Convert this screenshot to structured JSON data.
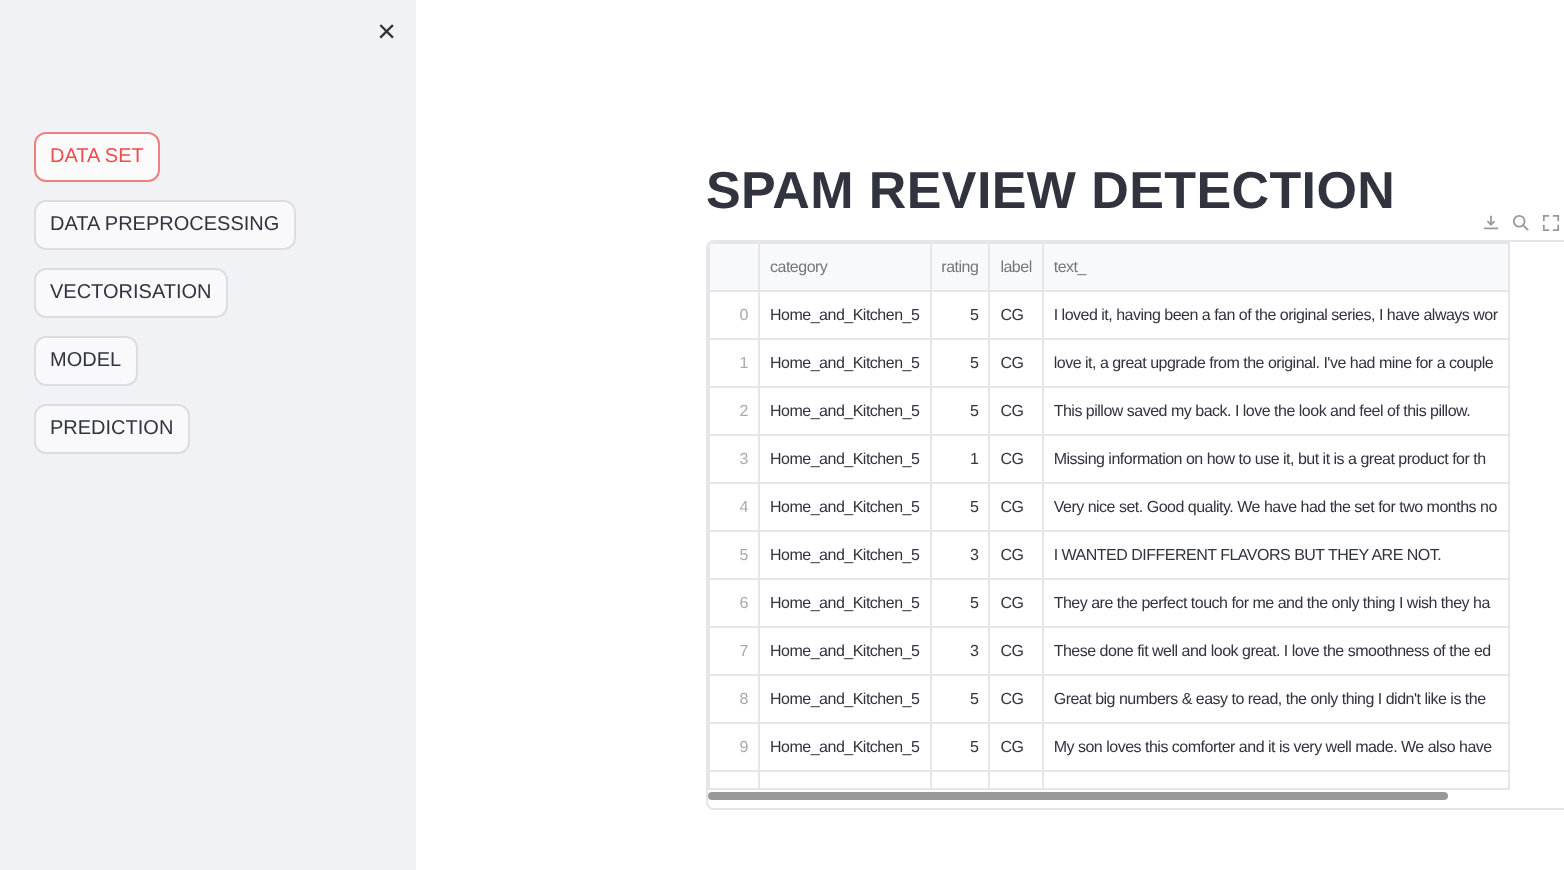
{
  "sidebar": {
    "close": "×",
    "items": [
      {
        "label": "DATA SET",
        "selected": true
      },
      {
        "label": "DATA PREPROCESSING",
        "selected": false
      },
      {
        "label": "VECTORISATION",
        "selected": false
      },
      {
        "label": "MODEL",
        "selected": false
      },
      {
        "label": "PREDICTION",
        "selected": false
      }
    ]
  },
  "title": "SPAM REVIEW DETECTION",
  "table": {
    "columns": [
      "",
      "category",
      "rating",
      "label",
      "text_"
    ],
    "rows": [
      [
        "0",
        "Home_and_Kitchen_5",
        "5",
        "CG",
        "I loved it, having been a fan of the original series, I have always wor"
      ],
      [
        "1",
        "Home_and_Kitchen_5",
        "5",
        "CG",
        "love it, a great upgrade from the original.  I've had mine for a couple"
      ],
      [
        "2",
        "Home_and_Kitchen_5",
        "5",
        "CG",
        "This pillow saved my back. I love the look and feel of this pillow."
      ],
      [
        "3",
        "Home_and_Kitchen_5",
        "1",
        "CG",
        "Missing information on how to use it, but it is a great product for th"
      ],
      [
        "4",
        "Home_and_Kitchen_5",
        "5",
        "CG",
        "Very nice set. Good quality. We have had the set for two months no"
      ],
      [
        "5",
        "Home_and_Kitchen_5",
        "3",
        "CG",
        "I WANTED DIFFERENT FLAVORS BUT THEY ARE NOT."
      ],
      [
        "6",
        "Home_and_Kitchen_5",
        "5",
        "CG",
        "They are the perfect touch for me and the only thing I wish they ha"
      ],
      [
        "7",
        "Home_and_Kitchen_5",
        "3",
        "CG",
        "These done fit well and look great.  I love the smoothness of the ed"
      ],
      [
        "8",
        "Home_and_Kitchen_5",
        "5",
        "CG",
        "Great big numbers & easy to read, the only thing I didn't like is the"
      ],
      [
        "9",
        "Home_and_Kitchen_5",
        "5",
        "CG",
        "My son loves this comforter and it is very well made.  We also have"
      ]
    ]
  }
}
